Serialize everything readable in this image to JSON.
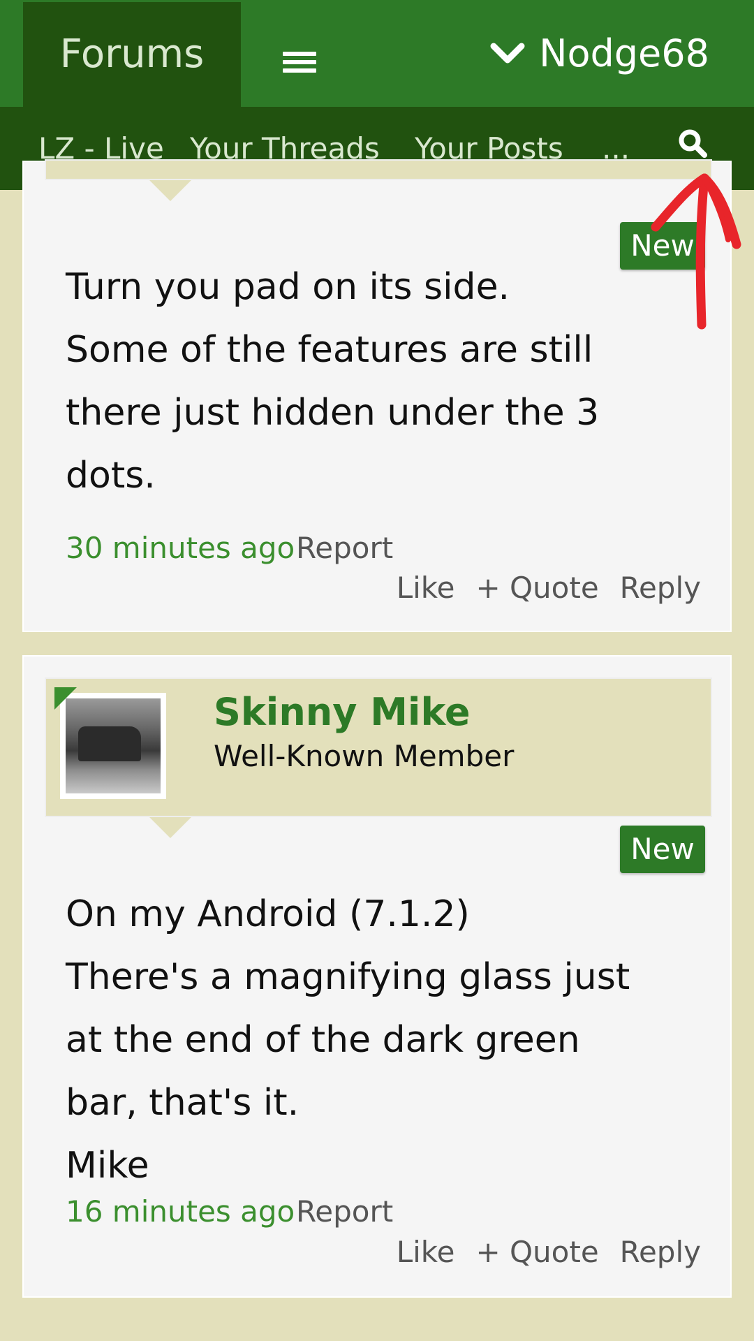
{
  "header": {
    "forums_label": "Forums",
    "username": "Nodge68"
  },
  "subnav": {
    "items": [
      "LZ - Live",
      "Your Threads",
      "Your Posts",
      "..."
    ]
  },
  "posts": [
    {
      "badge": "New",
      "lines": [
        "Turn you pad on its side.",
        "Some of the features are still",
        "there just hidden under the 3",
        "dots."
      ],
      "time": "30 minutes ago",
      "report": "Report",
      "actions": {
        "like": "Like",
        "quote": "+ Quote",
        "reply": "Reply"
      }
    },
    {
      "author": "Skinny Mike",
      "author_title": "Well-Known Member",
      "badge": "New",
      "lines": [
        "On my Android (7.1.2)",
        "There's a magnifying glass just",
        "at the end of the dark green",
        "bar, that's it.",
        "Mike"
      ],
      "time": "16 minutes ago",
      "report": "Report",
      "actions": {
        "like": "Like",
        "quote": "+ Quote",
        "reply": "Reply"
      }
    }
  ],
  "colors": {
    "brand_green": "#2d7a27",
    "dark_green": "#21520f",
    "page_background": "#e3e0bb",
    "annotation_red": "#e8252a"
  },
  "icons": {
    "menu": "hamburger-icon",
    "user_dropdown": "chevron-down-icon",
    "search": "search-icon"
  }
}
